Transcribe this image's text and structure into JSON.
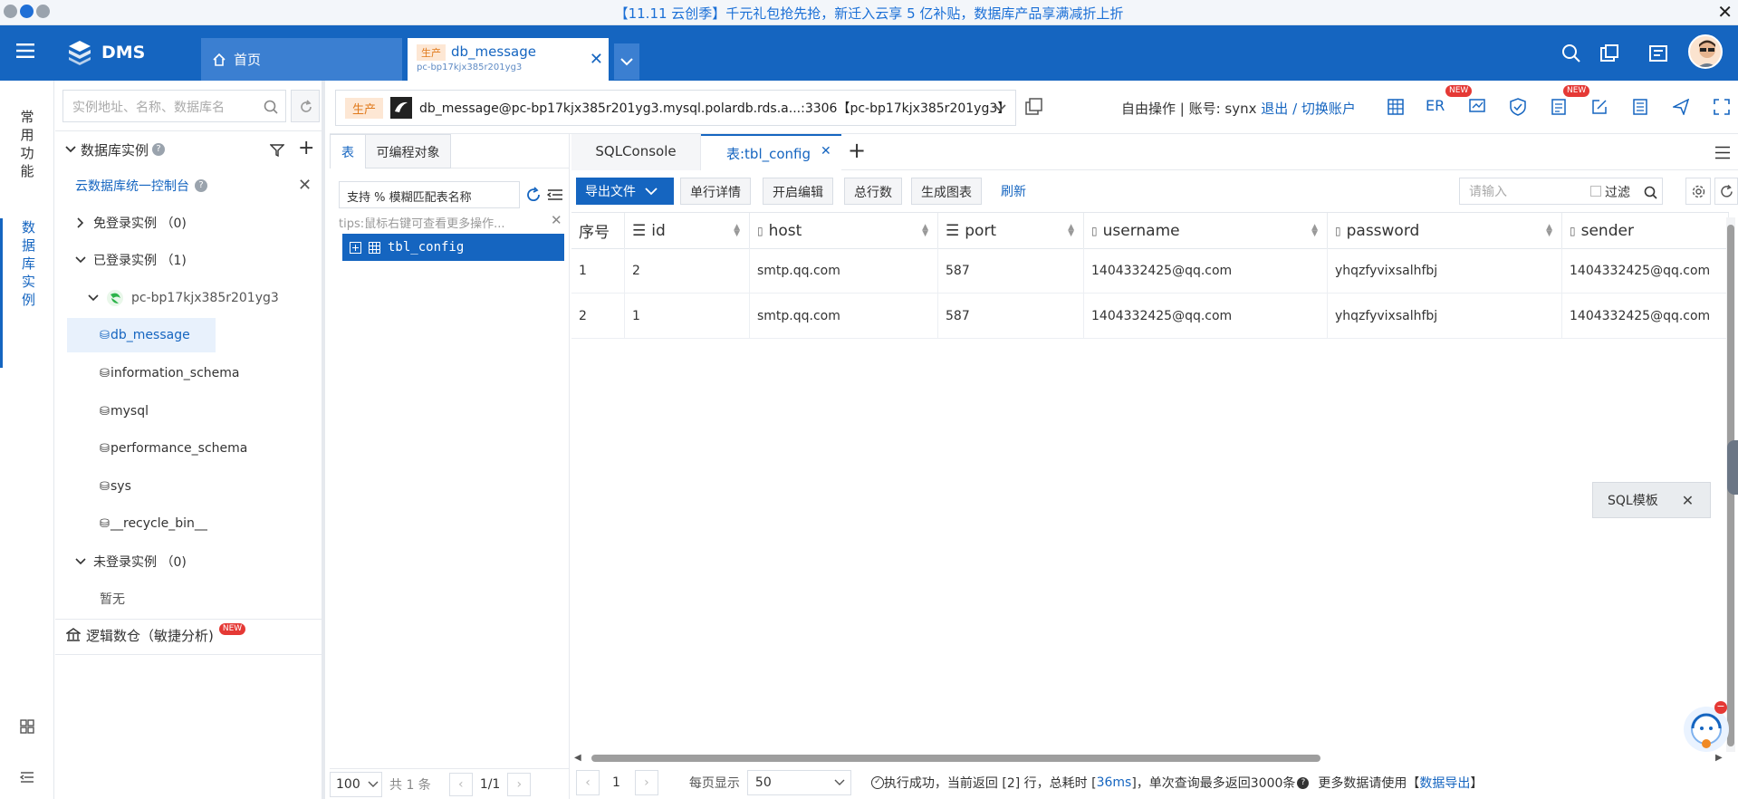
{
  "banner": {
    "text": "【11.11 云创季】千元礼包抢先抢，新迁入云享 5 亿补贴，数据库产品享满减折上折"
  },
  "header": {
    "logo_text": "DMS",
    "tabs": [
      {
        "label": "首页"
      },
      {
        "tag": "生产",
        "label": "db_message",
        "sub": "pc-bp17kjx385r201yg3"
      }
    ]
  },
  "rail": {
    "common": "常用功能",
    "db_instances": "数据库实例"
  },
  "explorer": {
    "search_placeholder": "实例地址、名称、数据库名",
    "title": "数据库实例",
    "console_link": "云数据库统一控制台",
    "groups": {
      "free": "免登录实例 （0)",
      "logged": "已登录实例 （1)",
      "instance": "pc-bp17kjx385r201yg3",
      "not_logged": "未登录实例 （0)",
      "none": "暂无"
    },
    "databases": [
      "db_message",
      "information_schema",
      "mysql",
      "performance_schema",
      "sys",
      "__recycle_bin__"
    ],
    "logic_dw": "逻辑数仓（敏捷分析)",
    "new_badge": "NEW"
  },
  "topbar": {
    "env_tag": "生产",
    "connection": "db_message@pc-bp17kjx385r201yg3.mysql.polardb.rds.a...:3306【pc-bp17kjx385r201yg3】",
    "mode": "自由操作 | 账号: synx",
    "logout": "退出",
    "sep": "/",
    "switch": "切换账户",
    "er": "ER"
  },
  "objects": {
    "tabs": [
      "表",
      "可编程对象"
    ],
    "filter_placeholder": "支持 % 模糊匹配表名称",
    "tips": "tips:鼠标右键可查看更多操作...",
    "tables": [
      "tbl_config"
    ],
    "page_size": "100",
    "total": "共 1 条",
    "pages": "1/1"
  },
  "editor": {
    "tabs": [
      "SQLConsole",
      "表:tbl_config"
    ],
    "toolbar": {
      "export": "导出文件",
      "row_detail": "单行详情",
      "edit": "开启编辑",
      "total_rows": "总行数",
      "chart": "生成图表",
      "refresh": "刷新",
      "search_placeholder": "请输入",
      "filter": "过滤"
    },
    "columns": [
      "序号",
      "id",
      "host",
      "port",
      "username",
      "password",
      "sender"
    ],
    "rows": [
      [
        "1",
        "2",
        "smtp.qq.com",
        "587",
        "1404332425@qq.com",
        "yhqzfyvixsalhfbj",
        "1404332425@qq.com"
      ],
      [
        "2",
        "1",
        "smtp.qq.com",
        "587",
        "1404332425@qq.com",
        "yhqzfyvixsalhfbj",
        "1404332425@qq.com"
      ]
    ],
    "sql_template": "SQL模板",
    "status": {
      "page": "1",
      "per_page_label": "每页显示",
      "per_page": "50",
      "msg": "执行成功，当前返回 [2] 行，总耗时 [",
      "ms": "36ms",
      "msg2": "]，单次查询最多返回3000条",
      "more": "更多数据请使用【",
      "export_link": "数据导出",
      "close": "】"
    }
  },
  "colors": {
    "brand": "#1565c0",
    "accent_orange": "#e07a1c",
    "new_badge": "#e53935"
  }
}
